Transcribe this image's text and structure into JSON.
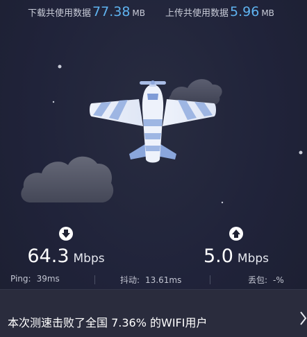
{
  "stats": {
    "download": {
      "label": "下载共使用数据",
      "value": "77.38",
      "unit": "MB"
    },
    "upload": {
      "label": "上传共使用数据",
      "value": "5.96",
      "unit": "MB"
    }
  },
  "icons": {
    "download": "arrow-down-circle-icon",
    "upload": "arrow-up-circle-icon",
    "banner": "chevron-right-icon"
  },
  "speeds": {
    "download": {
      "value": "64.3",
      "unit": "Mbps"
    },
    "upload": {
      "value": "5.0",
      "unit": "Mbps"
    }
  },
  "metrics": {
    "ping": {
      "label": "Ping:",
      "value": "39ms"
    },
    "jitter": {
      "label": "抖动:",
      "value": "13.61ms"
    },
    "loss": {
      "label": "丢包:",
      "value": "-%"
    }
  },
  "banner": {
    "text": "本次测速击败了全国 7.36% 的WIFI用户"
  },
  "colors": {
    "accent": "#5fb3f0",
    "background": "#1f2233",
    "banner": "#2a2c3d"
  }
}
